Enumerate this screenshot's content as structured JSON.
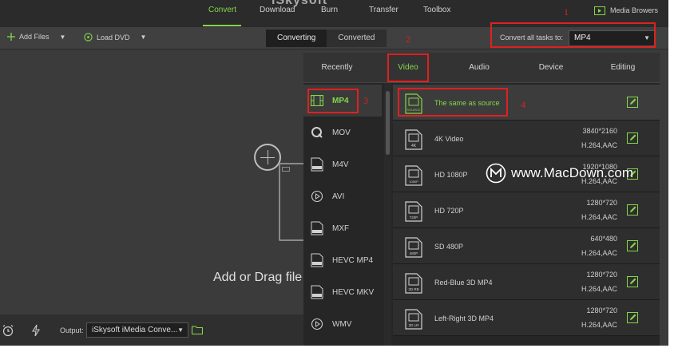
{
  "app": {
    "logo_text": "iSkysoft",
    "nav": [
      {
        "label": "Convert",
        "active": true
      },
      {
        "label": "Download",
        "active": false
      },
      {
        "label": "Burn",
        "active": false
      },
      {
        "label": "Transfer",
        "active": false
      },
      {
        "label": "Toolbox",
        "active": false
      }
    ],
    "media_browser_label": "Media Browers"
  },
  "toolbar": {
    "add_files_label": "Add Files",
    "load_dvd_label": "Load DVD",
    "segments": [
      {
        "label": "Converting",
        "active": true
      },
      {
        "label": "Converted",
        "active": false
      }
    ],
    "convert_all_label": "Convert all tasks to:",
    "convert_all_value": "MP4"
  },
  "dropzone": {
    "hint": "Add or Drag file"
  },
  "bottombar": {
    "output_label": "Output:",
    "output_value": "iSkysoft iMedia Conve..."
  },
  "format_panel": {
    "tabs": [
      {
        "label": "Recently",
        "active": false
      },
      {
        "label": "Video",
        "active": true
      },
      {
        "label": "Audio",
        "active": false
      },
      {
        "label": "Device",
        "active": false
      },
      {
        "label": "Editing",
        "active": false
      }
    ],
    "formats": [
      {
        "label": "MP4",
        "icon": "film-icon",
        "active": true
      },
      {
        "label": "MOV",
        "icon": "quicktime-icon",
        "active": false
      },
      {
        "label": "M4V",
        "icon": "file-m4v-icon",
        "active": false
      },
      {
        "label": "AVI",
        "icon": "play-circle-icon",
        "active": false
      },
      {
        "label": "MXF",
        "icon": "file-mxf-icon",
        "active": false
      },
      {
        "label": "HEVC MP4",
        "icon": "file-hevc-icon",
        "active": false
      },
      {
        "label": "HEVC MKV",
        "icon": "file-hevc-icon",
        "active": false
      },
      {
        "label": "WMV",
        "icon": "play-circle-icon",
        "active": false
      }
    ],
    "presets": [
      {
        "name": "The same as source",
        "badge": "SOURCE",
        "resolution": "",
        "codec": "",
        "active": true
      },
      {
        "name": "4K Video",
        "badge": "4K",
        "resolution": "3840*2160",
        "codec": "H.264,AAC",
        "active": false
      },
      {
        "name": "HD 1080P",
        "badge": "1080P",
        "resolution": "1920*1080",
        "codec": "H.264,AAC",
        "active": false
      },
      {
        "name": "HD 720P",
        "badge": "720P",
        "resolution": "1280*720",
        "codec": "H.264,AAC",
        "active": false
      },
      {
        "name": "SD 480P",
        "badge": "480P",
        "resolution": "640*480",
        "codec": "H.264,AAC",
        "active": false
      },
      {
        "name": "Red-Blue 3D MP4",
        "badge": "3D RB",
        "resolution": "1280*720",
        "codec": "H.264,AAC",
        "active": false
      },
      {
        "name": "Left-Right 3D MP4",
        "badge": "3D LR",
        "resolution": "1280*720",
        "codec": "H.264,AAC",
        "active": false
      }
    ]
  },
  "annotations": [
    "1",
    "2",
    "3",
    "3",
    "4"
  ],
  "watermark": "www.MacDown.com",
  "colors": {
    "accent": "#86d64a",
    "annotation": "#e02020",
    "background": "#3b3b3b",
    "topbar": "#2b2b2b",
    "panel": "#262626"
  }
}
